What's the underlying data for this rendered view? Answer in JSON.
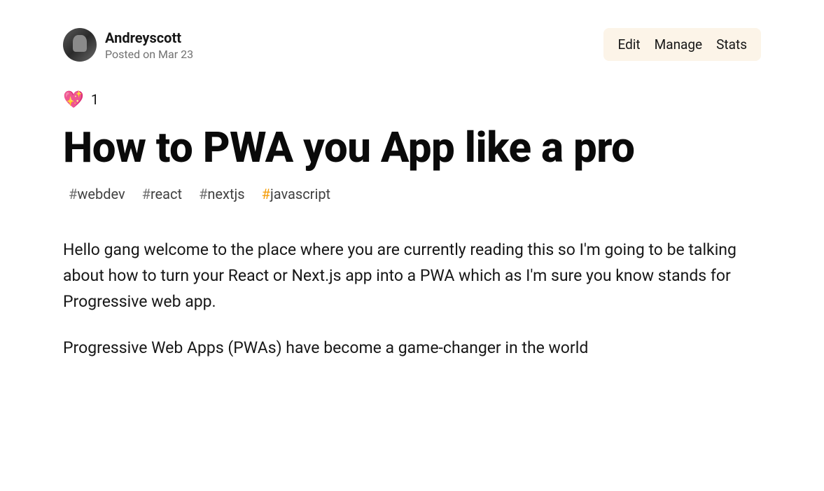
{
  "author": {
    "name": "Andreyscott",
    "posted_label": "Posted on Mar 23"
  },
  "actions": {
    "edit": "Edit",
    "manage": "Manage",
    "stats": "Stats"
  },
  "reactions": {
    "emoji": "💖",
    "count": "1"
  },
  "title": "How to PWA you App like a pro",
  "tags": [
    {
      "hash": "#",
      "text": "webdev",
      "highlight": false
    },
    {
      "hash": "#",
      "text": "react",
      "highlight": false
    },
    {
      "hash": "#",
      "text": "nextjs",
      "highlight": false
    },
    {
      "hash": "#",
      "text": "javascript",
      "highlight": true
    }
  ],
  "paragraphs": [
    "Hello gang welcome to the place where you are currently reading this so I'm going to be talking about how to turn your React or Next.js app into a PWA which as I'm sure you know stands for Progressive web app.",
    "Progressive Web Apps (PWAs) have become a game-changer in the world"
  ]
}
